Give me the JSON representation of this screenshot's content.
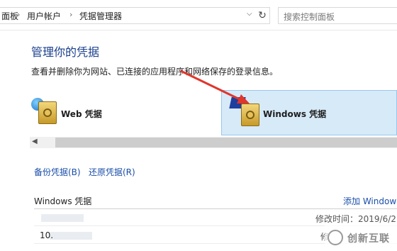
{
  "address_bar": {
    "crumbs": [
      "面板",
      "用户帐户",
      "凭据管理器"
    ],
    "search_placeholder": "搜索控制面板"
  },
  "page": {
    "title": "管理你的凭据",
    "description": "查看并删除你为网站、已连接的应用程序和网络保存的登录信息。"
  },
  "tiles": {
    "web_label": "Web 凭据",
    "windows_label": "Windows 凭据",
    "selected": "windows"
  },
  "actions": {
    "backup": "备份凭据(B)",
    "restore": "还原凭据(R)"
  },
  "section": {
    "title": "Windows 凭据",
    "add_link": "添加 Window"
  },
  "rows": [
    {
      "name": "",
      "meta": "修改时间：2019/6/2"
    },
    {
      "name": "10.",
      "meta": "修"
    }
  ],
  "watermark": {
    "text": "创新互联"
  },
  "colors": {
    "accent": "#1a4ea8",
    "title": "#1a3e8c",
    "selected_tile": "#d6eaf8",
    "arrow": "#e0362c"
  }
}
